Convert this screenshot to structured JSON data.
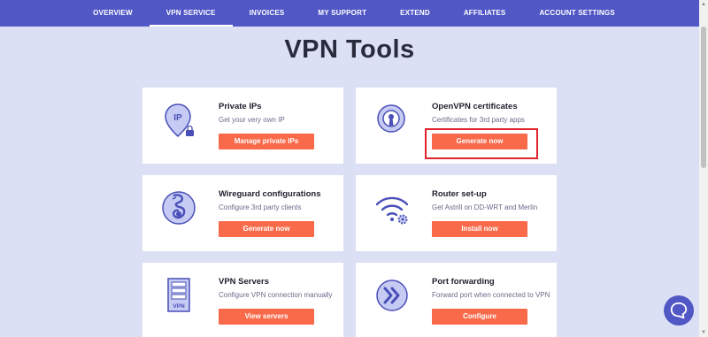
{
  "nav": {
    "items": [
      {
        "label": "OVERVIEW",
        "active": false
      },
      {
        "label": "VPN SERVICE",
        "active": true
      },
      {
        "label": "INVOICES",
        "active": false
      },
      {
        "label": "MY SUPPORT",
        "active": false
      },
      {
        "label": "EXTEND",
        "active": false
      },
      {
        "label": "AFFILIATES",
        "active": false
      },
      {
        "label": "ACCOUNT SETTINGS",
        "active": false
      }
    ]
  },
  "page": {
    "title": "VPN Tools"
  },
  "cards": [
    {
      "title": "Private IPs",
      "desc": "Get your very own IP",
      "button": "Manage private IPs",
      "icon": "location-pin-lock-icon"
    },
    {
      "title": "OpenVPN certificates",
      "desc": "Certificates for 3rd party apps",
      "button": "Generate now",
      "icon": "certificate-keyhole-icon"
    },
    {
      "title": "Wireguard configurations",
      "desc": "Configure 3rd party clients",
      "button": "Generate now",
      "icon": "wireguard-dragon-icon"
    },
    {
      "title": "Router set-up",
      "desc": "Get Astrill on DD-WRT and Merlin",
      "button": "Install now",
      "icon": "wifi-gear-icon"
    },
    {
      "title": "VPN Servers",
      "desc": "Configure VPN connection manually",
      "button": "View servers",
      "icon": "server-rack-icon"
    },
    {
      "title": "Port forwarding",
      "desc": "Forward port when connected to VPN",
      "button": "Configure",
      "icon": "double-chevron-right-icon"
    }
  ],
  "server_icon_label": "VPN",
  "pin_icon_label": "IP",
  "colors": {
    "nav_bg": "#5158c6",
    "page_bg": "#dce0f4",
    "button": "#f96a4a",
    "highlight": "#e0242b",
    "icon_fill": "#c5cbf3",
    "icon_stroke": "#4a4fb8"
  }
}
